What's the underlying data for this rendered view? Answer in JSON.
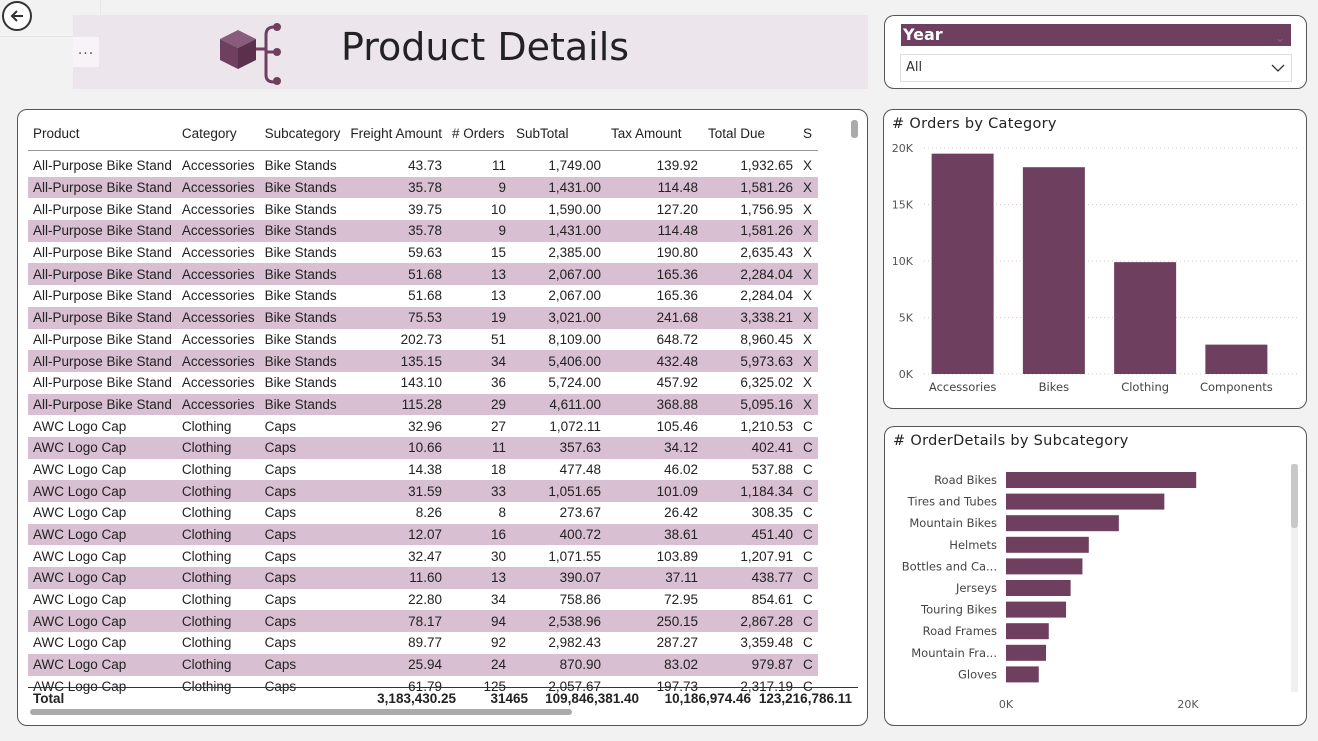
{
  "header": {
    "title": "Product Details",
    "more_label": "..."
  },
  "nav": {
    "back_icon": "arrow-left-circle-icon"
  },
  "slicer": {
    "title": "Year",
    "value": "All"
  },
  "table": {
    "columns": [
      "Product",
      "Category",
      "Subcategory",
      "Freight Amount",
      "# Orders",
      "SubTotal",
      "Tax Amount",
      "Total Due",
      "S"
    ],
    "rows": [
      [
        "All-Purpose Bike Stand",
        "Accessories",
        "Bike Stands",
        "43.73",
        "11",
        "1,749.00",
        "139.92",
        "1,932.65",
        "X"
      ],
      [
        "All-Purpose Bike Stand",
        "Accessories",
        "Bike Stands",
        "35.78",
        "9",
        "1,431.00",
        "114.48",
        "1,581.26",
        "X"
      ],
      [
        "All-Purpose Bike Stand",
        "Accessories",
        "Bike Stands",
        "39.75",
        "10",
        "1,590.00",
        "127.20",
        "1,756.95",
        "X"
      ],
      [
        "All-Purpose Bike Stand",
        "Accessories",
        "Bike Stands",
        "35.78",
        "9",
        "1,431.00",
        "114.48",
        "1,581.26",
        "X"
      ],
      [
        "All-Purpose Bike Stand",
        "Accessories",
        "Bike Stands",
        "59.63",
        "15",
        "2,385.00",
        "190.80",
        "2,635.43",
        "X"
      ],
      [
        "All-Purpose Bike Stand",
        "Accessories",
        "Bike Stands",
        "51.68",
        "13",
        "2,067.00",
        "165.36",
        "2,284.04",
        "X"
      ],
      [
        "All-Purpose Bike Stand",
        "Accessories",
        "Bike Stands",
        "51.68",
        "13",
        "2,067.00",
        "165.36",
        "2,284.04",
        "X"
      ],
      [
        "All-Purpose Bike Stand",
        "Accessories",
        "Bike Stands",
        "75.53",
        "19",
        "3,021.00",
        "241.68",
        "3,338.21",
        "X"
      ],
      [
        "All-Purpose Bike Stand",
        "Accessories",
        "Bike Stands",
        "202.73",
        "51",
        "8,109.00",
        "648.72",
        "8,960.45",
        "X"
      ],
      [
        "All-Purpose Bike Stand",
        "Accessories",
        "Bike Stands",
        "135.15",
        "34",
        "5,406.00",
        "432.48",
        "5,973.63",
        "X"
      ],
      [
        "All-Purpose Bike Stand",
        "Accessories",
        "Bike Stands",
        "143.10",
        "36",
        "5,724.00",
        "457.92",
        "6,325.02",
        "X"
      ],
      [
        "All-Purpose Bike Stand",
        "Accessories",
        "Bike Stands",
        "115.28",
        "29",
        "4,611.00",
        "368.88",
        "5,095.16",
        "X"
      ],
      [
        "AWC Logo Cap",
        "Clothing",
        "Caps",
        "32.96",
        "27",
        "1,072.11",
        "105.46",
        "1,210.53",
        "C"
      ],
      [
        "AWC Logo Cap",
        "Clothing",
        "Caps",
        "10.66",
        "11",
        "357.63",
        "34.12",
        "402.41",
        "C"
      ],
      [
        "AWC Logo Cap",
        "Clothing",
        "Caps",
        "14.38",
        "18",
        "477.48",
        "46.02",
        "537.88",
        "C"
      ],
      [
        "AWC Logo Cap",
        "Clothing",
        "Caps",
        "31.59",
        "33",
        "1,051.65",
        "101.09",
        "1,184.34",
        "C"
      ],
      [
        "AWC Logo Cap",
        "Clothing",
        "Caps",
        "8.26",
        "8",
        "273.67",
        "26.42",
        "308.35",
        "C"
      ],
      [
        "AWC Logo Cap",
        "Clothing",
        "Caps",
        "12.07",
        "16",
        "400.72",
        "38.61",
        "451.40",
        "C"
      ],
      [
        "AWC Logo Cap",
        "Clothing",
        "Caps",
        "32.47",
        "30",
        "1,071.55",
        "103.89",
        "1,207.91",
        "C"
      ],
      [
        "AWC Logo Cap",
        "Clothing",
        "Caps",
        "11.60",
        "13",
        "390.07",
        "37.11",
        "438.77",
        "C"
      ],
      [
        "AWC Logo Cap",
        "Clothing",
        "Caps",
        "22.80",
        "34",
        "758.86",
        "72.95",
        "854.61",
        "C"
      ],
      [
        "AWC Logo Cap",
        "Clothing",
        "Caps",
        "78.17",
        "94",
        "2,538.96",
        "250.15",
        "2,867.28",
        "C"
      ],
      [
        "AWC Logo Cap",
        "Clothing",
        "Caps",
        "89.77",
        "92",
        "2,982.43",
        "287.27",
        "3,359.48",
        "C"
      ],
      [
        "AWC Logo Cap",
        "Clothing",
        "Caps",
        "25.94",
        "24",
        "870.90",
        "83.02",
        "979.87",
        "C"
      ],
      [
        "AWC Logo Cap",
        "Clothing",
        "Caps",
        "61.79",
        "125",
        "2,057.67",
        "197.73",
        "2,317.19",
        "C"
      ]
    ],
    "total": {
      "label": "Total",
      "freight": "3,183,430.25",
      "orders": "31465",
      "subtotal": "109,846,381.40",
      "tax": "10,186,974.46",
      "total_due": "123,216,786.11"
    }
  },
  "chart_data": [
    {
      "type": "bar",
      "title": "# Orders by Category",
      "categories": [
        "Accessories",
        "Bikes",
        "Clothing",
        "Components"
      ],
      "values": [
        19500,
        18300,
        9900,
        2600
      ],
      "ylim": [
        0,
        20000
      ],
      "yticks": [
        "0K",
        "5K",
        "10K",
        "15K",
        "20K"
      ],
      "color": "#6e3f5e"
    },
    {
      "type": "bar",
      "orientation": "horizontal",
      "title": "# OrderDetails by Subcategory",
      "categories": [
        "Road Bikes",
        "Tires and Tubes",
        "Mountain Bikes",
        "Helmets",
        "Bottles and Ca...",
        "Jerseys",
        "Touring Bikes",
        "Road Frames",
        "Mountain Fra...",
        "Gloves"
      ],
      "values": [
        20900,
        17400,
        12400,
        9100,
        8400,
        7100,
        6600,
        4700,
        4400,
        3600
      ],
      "xlim": [
        0,
        30000
      ],
      "xticks": [
        "0K",
        "20K"
      ],
      "color": "#6e3f5e"
    }
  ]
}
